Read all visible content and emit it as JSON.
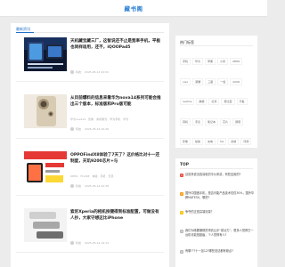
{
  "header": {
    "logo": "藏书阁"
  },
  "main": {
    "section_title": "最新资讯",
    "articles": [
      {
        "title": "天机藏宝藏三厂，这智说还不止是宽率手机，平板也同样适用，还不，iQOOPad5",
        "tags": [],
        "author": "科技",
        "date": "2025-05-14 20:52"
      },
      {
        "title": "从目前爆料的信息来看华为nova14系列可能会推出三个版本，标准版和Pro版可能",
        "tags": [
          "华为nova14",
          "影像",
          "新机曝光",
          "华为手机",
          "华为"
        ],
        "author": "科技",
        "date": "2025-05-14 20:26"
      },
      {
        "title": "OPPOFindX8体验了7天了？这价格比对十一还制度，天玑9200芯片+与",
        "tags": [
          "OPPO",
          "FindX8",
          "体验",
          "手机",
          "天玑"
        ],
        "author": "科技",
        "date": "2025-05-14 20:36"
      },
      {
        "title": "索尼Xperia的相机按键得到标准配置，可做没有人抄，大家守想这比iPhone",
        "tags": [],
        "author": "科技",
        "date": "2025-05-14 19:13"
      }
    ]
  },
  "hot_tags": {
    "title": "热门标签",
    "tags": [
      "手机",
      "华为",
      "苹果",
      "小米",
      "OPPO",
      "vivo",
      "荣耀",
      "三星",
      "一加",
      "iQOO",
      "realme",
      "魅族",
      "红米",
      "努比亚",
      "平板",
      "耳机",
      "手表",
      "笔记本",
      "芯片",
      "屏幕",
      "影像",
      "续航",
      "充电",
      "5G",
      "系统",
      "评测",
      "新机",
      "发布会",
      "鸿蒙",
      "安卓",
      "iOS",
      "折叠屏",
      "游戏",
      "摄影",
      "配件",
      "数码",
      "科技",
      "资讯"
    ]
  },
  "top": {
    "title": "TOP",
    "items": [
      {
        "rank": "1",
        "text": "目前来说无线耳机的平价来讲，有些应用的?"
      },
      {
        "rank": "2",
        "text": "国外中国做手机，是否可能产品技术仅仅30%，国外华跨MATE50，哪些?"
      },
      {
        "rank": "3",
        "text": "争夺的正是高端流量？"
      },
      {
        "rank": "4",
        "text": "我们为啥要爆那些事情让步“成功力”，很多人觉得它一台机可能是超级，个人觉得有人?"
      },
      {
        "rank": "5",
        "text": "有哪个?十一加12?哪些说法都有缺点?"
      }
    ]
  },
  "colors": {
    "accent": "#1e6fc7",
    "rank1": "#e74c3c",
    "rank2": "#f39c12",
    "rank3": "#f1c40f",
    "rank_other": "#bbbbbb"
  }
}
